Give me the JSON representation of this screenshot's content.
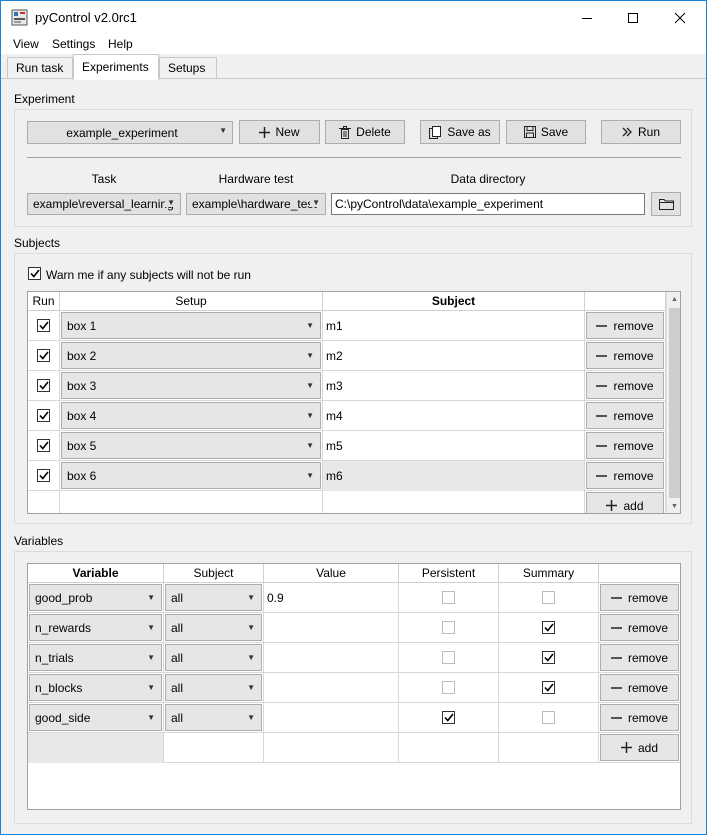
{
  "window": {
    "title": "pyControl v2.0rc1"
  },
  "menu": [
    "View",
    "Settings",
    "Help"
  ],
  "tabs": [
    "Run task",
    "Experiments",
    "Setups"
  ],
  "experiment": {
    "group_label": "Experiment",
    "selected": "example_experiment",
    "buttons": {
      "new": "New",
      "delete": "Delete",
      "save_as": "Save as",
      "save": "Save",
      "run": "Run"
    },
    "task_label": "Task",
    "task_value": "example\\reversal_learning",
    "hardware_label": "Hardware test",
    "hardware_value": "example\\hardware_test",
    "data_dir_label": "Data directory",
    "data_dir_value": "C:\\pyControl\\data\\example_experiment"
  },
  "subjects": {
    "group_label": "Subjects",
    "warn_label": "Warn me if any subjects will not be run",
    "warn_checked": true,
    "headers": {
      "run": "Run",
      "setup": "Setup",
      "subject": "Subject"
    },
    "rows": [
      {
        "run": true,
        "setup": "box 1",
        "subject": "m1"
      },
      {
        "run": true,
        "setup": "box 2",
        "subject": "m2"
      },
      {
        "run": true,
        "setup": "box 3",
        "subject": "m3"
      },
      {
        "run": true,
        "setup": "box 4",
        "subject": "m4"
      },
      {
        "run": true,
        "setup": "box 5",
        "subject": "m5"
      },
      {
        "run": true,
        "setup": "box 6",
        "subject": "m6"
      }
    ],
    "remove_label": "remove",
    "add_label": "add"
  },
  "variables": {
    "group_label": "Variables",
    "headers": {
      "variable": "Variable",
      "subject": "Subject",
      "value": "Value",
      "persistent": "Persistent",
      "summary": "Summary"
    },
    "rows": [
      {
        "variable": "good_prob",
        "subject": "all",
        "value": "0.9",
        "persistent": false,
        "summary": false
      },
      {
        "variable": "n_rewards",
        "subject": "all",
        "value": "",
        "persistent": false,
        "summary": true
      },
      {
        "variable": "n_trials",
        "subject": "all",
        "value": "",
        "persistent": false,
        "summary": true
      },
      {
        "variable": "n_blocks",
        "subject": "all",
        "value": "",
        "persistent": false,
        "summary": true
      },
      {
        "variable": "good_side",
        "subject": "all",
        "value": "",
        "persistent": true,
        "summary": false
      }
    ],
    "remove_label": "remove",
    "add_label": "add"
  }
}
